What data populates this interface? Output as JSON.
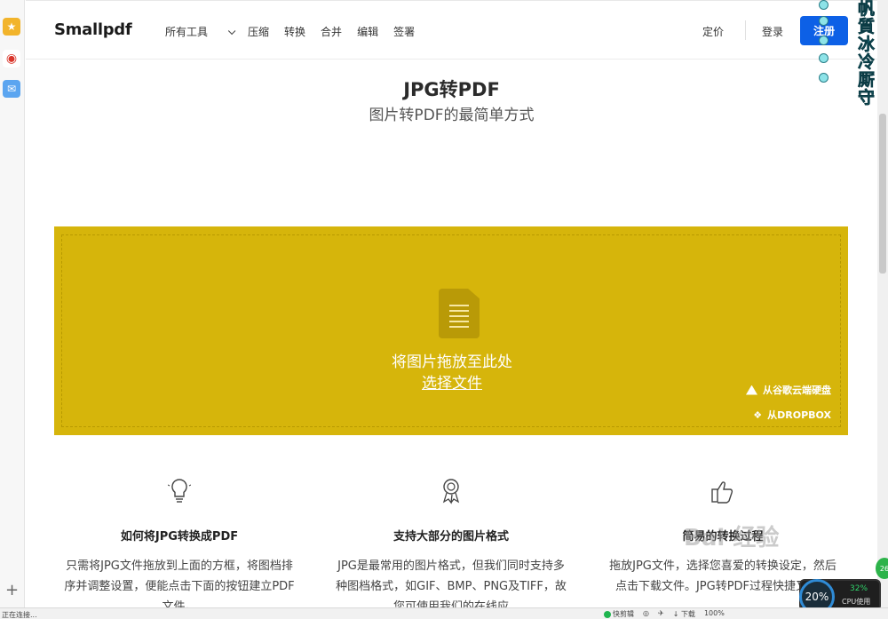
{
  "browser": {
    "status_text": "正在连接...",
    "statusbar_items": [
      "快剪辑",
      "下载",
      "100%"
    ],
    "sidebar_plus": "+"
  },
  "header": {
    "logo": "Smallpdf",
    "nav": [
      "所有工具",
      "压缩",
      "转换",
      "合并",
      "编辑",
      "签署"
    ],
    "pricing": "定价",
    "login": "登录",
    "signup": "注册"
  },
  "hero": {
    "title": "JPG转PDF",
    "subtitle": "图片转PDF的最简单方式"
  },
  "dropzone": {
    "drop_text": "将图片拖放至此处",
    "choose_file": "选择文件",
    "from_gdrive": "从谷歌云端硬盘",
    "from_dropbox": "从DROPBOX",
    "bg_color": "#d6b50b"
  },
  "features": [
    {
      "icon": "lightbulb-icon",
      "title": "如何将JPG转换成PDF",
      "desc": "只需将JPG文件拖放到上面的方框，将图档排序并调整设置，便能点击下面的按钮建立PDF文件。"
    },
    {
      "icon": "award-ribbon-icon",
      "title": "支持大部分的图片格式",
      "desc": "JPG是最常用的图片格式，但我们同时支持多种图档格式，如GIF、BMP、PNG及TIFF，故您可使用我们的在线应"
    },
    {
      "icon": "thumbs-up-icon",
      "title": "简易的转换过程",
      "desc": "拖放JPG文件，选择您喜爱的转换设定，然后点击下载文件。JPG转PDF过程快捷又方便"
    }
  ],
  "overlays": {
    "vertical_text": "帆 質 冰 冷 厮 守",
    "cpu_value": "20%",
    "cpu_percent": "32%",
    "cpu_label": "CPU使用",
    "badge": "26",
    "watermark": "Bai 经验"
  },
  "colors": {
    "accent": "#0d60e6",
    "dropzone": "#d6b50b"
  }
}
